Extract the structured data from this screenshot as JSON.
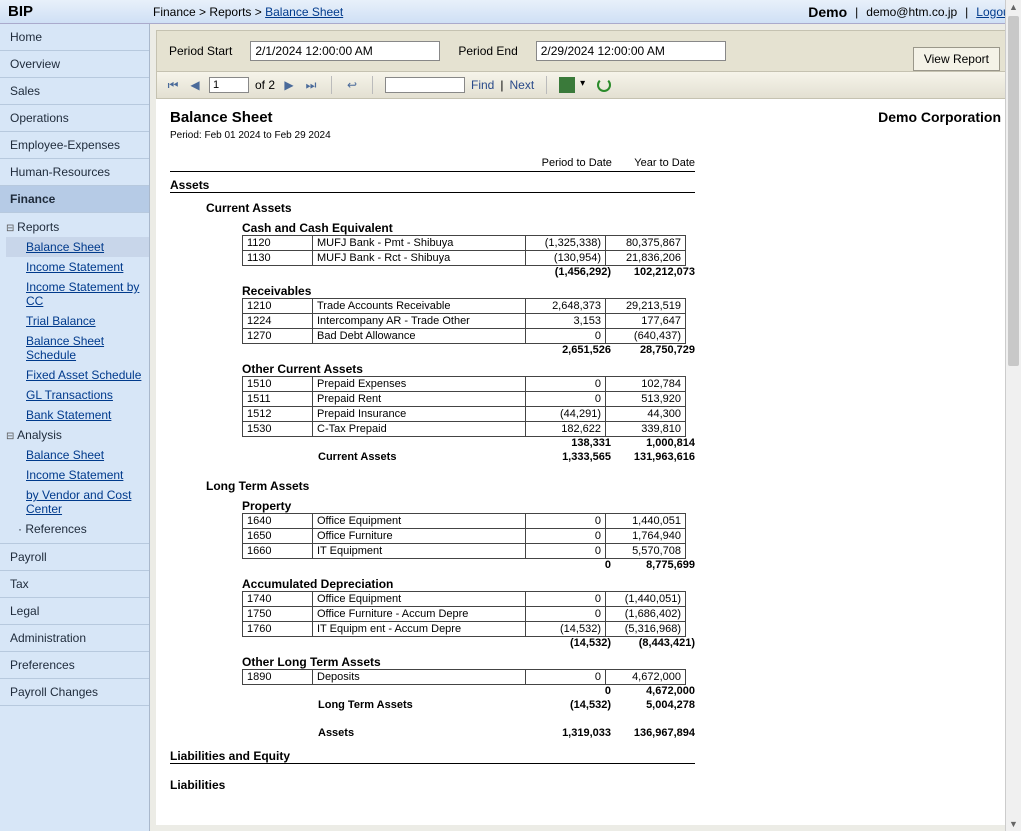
{
  "header": {
    "logo": "BIP",
    "breadcrumb": {
      "p1": "Finance",
      "p2": "Reports",
      "p3": "Balance Sheet"
    },
    "tenant": "Demo",
    "email": "demo@htm.co.jp",
    "logout": "Logout"
  },
  "sidebar": {
    "items_top": [
      "Home",
      "Overview",
      "Sales",
      "Operations",
      "Employee-Expenses",
      "Human-Resources"
    ],
    "finance": "Finance",
    "tree": {
      "reports": "Reports",
      "reports_items": [
        "Balance Sheet",
        "Income Statement",
        "Income Statement by CC",
        "Trial Balance",
        "Balance Sheet Schedule",
        "Fixed Asset Schedule",
        "GL Transactions",
        "Bank Statement"
      ],
      "analysis": "Analysis",
      "analysis_items": [
        "Balance Sheet",
        "Income Statement",
        "by Vendor and Cost Center"
      ],
      "references": "References"
    },
    "items_bottom": [
      "Payroll",
      "Tax",
      "Legal",
      "Administration",
      "Preferences",
      "Payroll Changes"
    ]
  },
  "params": {
    "start_label": "Period Start",
    "start_value": "2/1/2024 12:00:00 AM",
    "end_label": "Period End",
    "end_value": "2/29/2024 12:00:00 AM",
    "view_btn": "View Report"
  },
  "toolbar": {
    "page_value": "1",
    "of": "of 2",
    "find": "Find",
    "next": "Next"
  },
  "report": {
    "title": "Balance Sheet",
    "company": "Demo Corporation",
    "period": "Period: Feb 01 2024 to Feb 29 2024",
    "col_ptd": "Period to Date",
    "col_ytd": "Year to Date",
    "assets_title": "Assets",
    "current_assets": "Current Assets",
    "cash_title": "Cash and Cash Equivalent",
    "cash_rows": [
      {
        "code": "1120",
        "name": "MUFJ Bank - Pmt - Shibuya",
        "ptd": "(1,325,338)",
        "ytd": "80,375,867"
      },
      {
        "code": "1130",
        "name": "MUFJ Bank - Rct - Shibuya",
        "ptd": "(130,954)",
        "ytd": "21,836,206"
      }
    ],
    "cash_total": {
      "ptd": "(1,456,292)",
      "ytd": "102,212,073"
    },
    "recv_title": "Receivables",
    "recv_rows": [
      {
        "code": "1210",
        "name": "Trade Accounts Receivable",
        "ptd": "2,648,373",
        "ytd": "29,213,519"
      },
      {
        "code": "1224",
        "name": "Intercompany AR - Trade Other",
        "ptd": "3,153",
        "ytd": "177,647"
      },
      {
        "code": "1270",
        "name": "Bad Debt Allowance",
        "ptd": "0",
        "ytd": "(640,437)"
      }
    ],
    "recv_total": {
      "ptd": "2,651,526",
      "ytd": "28,750,729"
    },
    "oca_title": "Other Current Assets",
    "oca_rows": [
      {
        "code": "1510",
        "name": "Prepaid Expenses",
        "ptd": "0",
        "ytd": "102,784"
      },
      {
        "code": "1511",
        "name": "Prepaid Rent",
        "ptd": "0",
        "ytd": "513,920"
      },
      {
        "code": "1512",
        "name": "Prepaid Insurance",
        "ptd": "(44,291)",
        "ytd": "44,300"
      },
      {
        "code": "1530",
        "name": "C-Tax Prepaid",
        "ptd": "182,622",
        "ytd": "339,810"
      }
    ],
    "oca_total": {
      "ptd": "138,331",
      "ytd": "1,000,814"
    },
    "ca_total": {
      "label": "Current Assets",
      "ptd": "1,333,565",
      "ytd": "131,963,616"
    },
    "lta_title": "Long Term Assets",
    "prop_title": "Property",
    "prop_rows": [
      {
        "code": "1640",
        "name": "Office Equipment",
        "ptd": "0",
        "ytd": "1,440,051"
      },
      {
        "code": "1650",
        "name": "Office Furniture",
        "ptd": "0",
        "ytd": "1,764,940"
      },
      {
        "code": "1660",
        "name": "IT Equipment",
        "ptd": "0",
        "ytd": "5,570,708"
      }
    ],
    "prop_total": {
      "ptd": "0",
      "ytd": "8,775,699"
    },
    "acdep_title": "Accumulated Depreciation",
    "acdep_rows": [
      {
        "code": "1740",
        "name": "Office Equipment",
        "ptd": "0",
        "ytd": "(1,440,051)"
      },
      {
        "code": "1750",
        "name": "Office Furniture - Accum Depre",
        "ptd": "0",
        "ytd": "(1,686,402)"
      },
      {
        "code": "1760",
        "name": "IT Equipm ent - Accum Depre",
        "ptd": "(14,532)",
        "ytd": "(5,316,968)"
      }
    ],
    "acdep_total": {
      "ptd": "(14,532)",
      "ytd": "(8,443,421)"
    },
    "olta_title": "Other Long Term Assets",
    "olta_rows": [
      {
        "code": "1890",
        "name": "Deposits",
        "ptd": "0",
        "ytd": "4,672,000"
      }
    ],
    "olta_total": {
      "ptd": "0",
      "ytd": "4,672,000"
    },
    "lta_total": {
      "label": "Long Term Assets",
      "ptd": "(14,532)",
      "ytd": "5,004,278"
    },
    "assets_total": {
      "label": "Assets",
      "ptd": "1,319,033",
      "ytd": "136,967,894"
    },
    "liab_eq_title": "Liabilities and Equity",
    "liab_title": "Liabilities"
  }
}
